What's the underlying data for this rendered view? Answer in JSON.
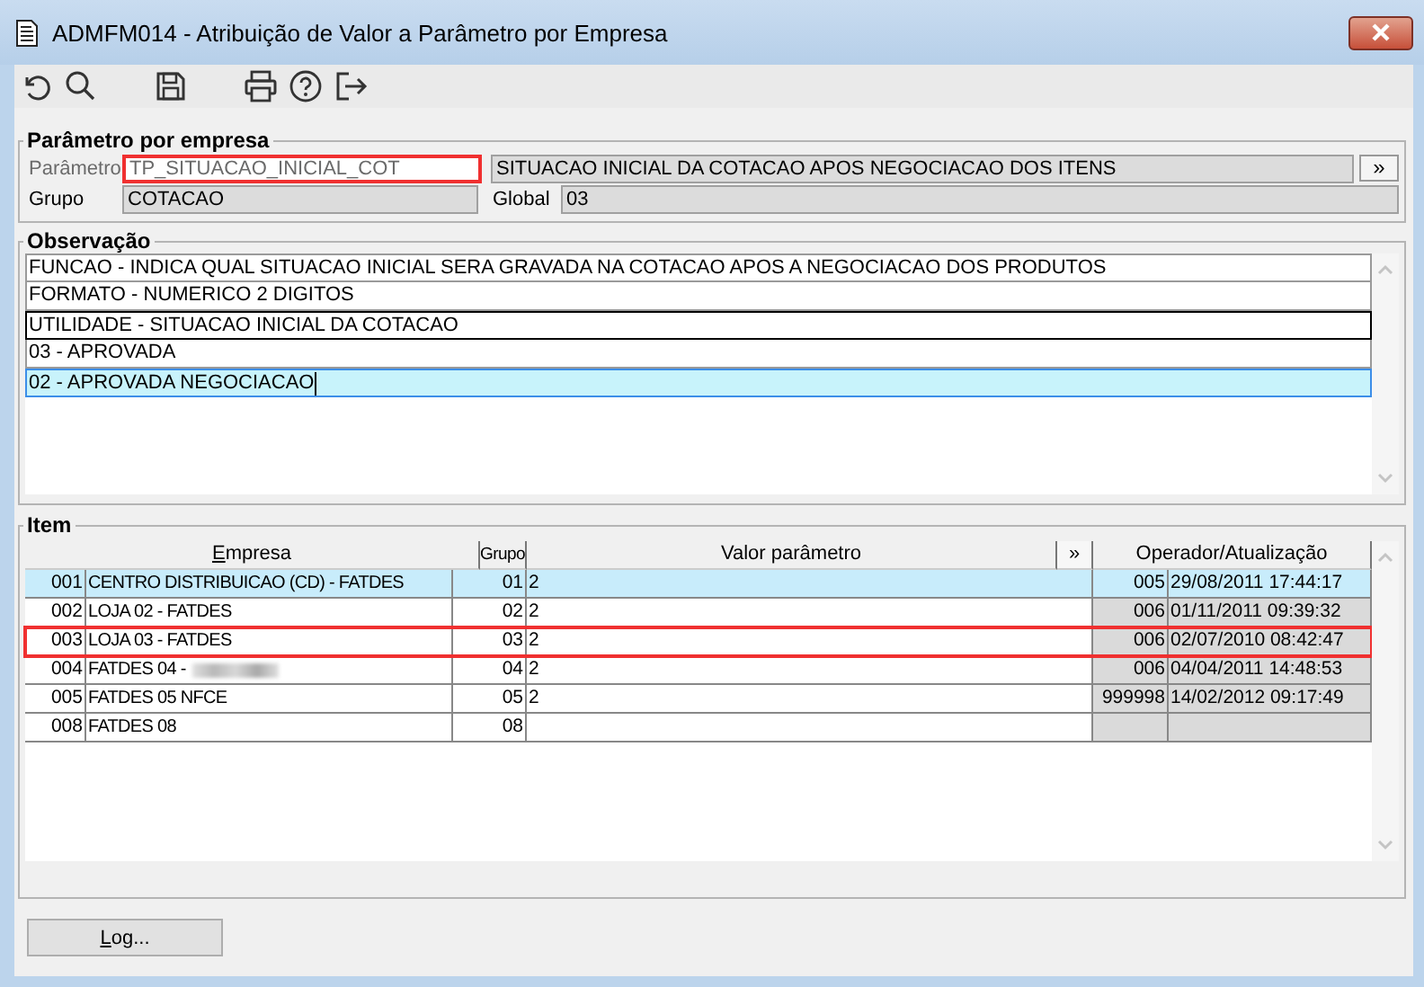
{
  "window": {
    "title": "ADMFM014 - Atribuição de Valor a Parâmetro por Empresa"
  },
  "toolbar": [
    {
      "kind": "undo"
    },
    {
      "kind": "search"
    },
    {
      "kind": "save"
    },
    {
      "kind": "print"
    },
    {
      "kind": "help"
    },
    {
      "kind": "exit"
    }
  ],
  "parameter_group": {
    "title": "Parâmetro por empresa",
    "parameter": {
      "label": "Parâmetro",
      "value": "TP_SITUACAO_INICIAL_COT",
      "disabled": true,
      "marked": true
    },
    "description": "SITUACAO INICIAL DA COTACAO APOS NEGOCIACAO DOS ITENS",
    "expand_button": "»",
    "group": {
      "label": "Grupo",
      "value": "COTACAO"
    },
    "global": {
      "label": "Global",
      "value": "03"
    }
  },
  "observation": {
    "title": "Observação",
    "lines": [
      {
        "text": "FUNCAO - INDICA QUAL SITUACAO INICIAL SERA GRAVADA NA COTACAO APOS A NEGOCIACAO DOS PRODUTOS",
        "selected": false,
        "focused": false
      },
      {
        "text": "FORMATO - NUMERICO 2 DIGITOS",
        "selected": false,
        "focused": false
      },
      {
        "text": "UTILIDADE - SITUACAO INICIAL DA COTACAO",
        "selected": false,
        "focused": true
      },
      {
        "text": "03 - APROVADA",
        "selected": false,
        "focused": false
      },
      {
        "text": "02 - APROVADA NEGOCIACAO",
        "selected": true,
        "focused": false
      }
    ]
  },
  "items": {
    "title": "Item",
    "columns": [
      {
        "label": "Empresa"
      },
      {
        "label": "Grupo"
      },
      {
        "label": "Valor parâmetro"
      },
      {
        "label": "»"
      },
      {
        "label": "Operador/Atualização"
      }
    ],
    "rows": [
      {
        "code": "001",
        "empresa": "CENTRO DISTRIBUICAO (CD) - FATDES",
        "grupo": "01",
        "valor": "2",
        "operador": "005",
        "atualizacao": "29/08/2011 17:44:17",
        "selected": true,
        "marked": false,
        "redacted": false
      },
      {
        "code": "002",
        "empresa": "LOJA 02 - FATDES",
        "grupo": "02",
        "valor": "2",
        "operador": "006",
        "atualizacao": "01/11/2011 09:39:32",
        "selected": false,
        "marked": false,
        "redacted": false
      },
      {
        "code": "003",
        "empresa": "LOJA 03 - FATDES",
        "grupo": "03",
        "valor": "2",
        "operador": "006",
        "atualizacao": "02/07/2010 08:42:47",
        "selected": false,
        "marked": true,
        "redacted": false
      },
      {
        "code": "004",
        "empresa": "FATDES 04 -",
        "grupo": "04",
        "valor": "2",
        "operador": "006",
        "atualizacao": "04/04/2011 14:48:53",
        "selected": false,
        "marked": false,
        "redacted": true
      },
      {
        "code": "005",
        "empresa": "FATDES 05 NFCE",
        "grupo": "05",
        "valor": "2",
        "operador": "999998",
        "atualizacao": "14/02/2012 09:17:49",
        "selected": false,
        "marked": false,
        "redacted": false
      },
      {
        "code": "008",
        "empresa": "FATDES 08",
        "grupo": "08",
        "selected": false,
        "marked": false,
        "redacted": false
      }
    ]
  },
  "buttons": [
    {
      "label": "Log..."
    }
  ]
}
